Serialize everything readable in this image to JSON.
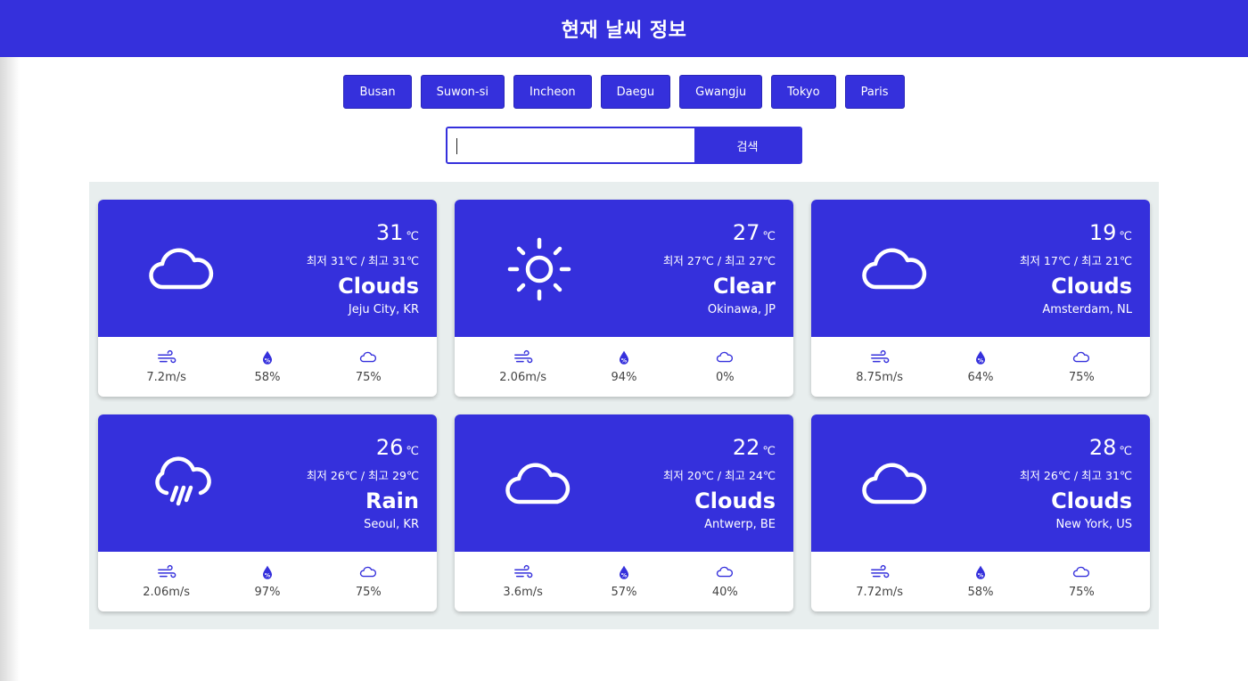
{
  "header": {
    "title": "현재 날씨 정보"
  },
  "city_buttons": [
    "Busan",
    "Suwon-si",
    "Incheon",
    "Daegu",
    "Gwangju",
    "Tokyo",
    "Paris"
  ],
  "search": {
    "value": "",
    "placeholder": "",
    "button_label": "검색"
  },
  "labels": {
    "min": "최저",
    "max": "최고",
    "unit": "℃",
    "sep": "/"
  },
  "accent_color": "#3530dc",
  "cards": [
    {
      "icon": "cloud-icon",
      "temp": "31",
      "min": "31",
      "max": "31",
      "main": "Clouds",
      "location": "Jeju City, KR",
      "wind": "7.2m/s",
      "humidity": "58%",
      "cloudiness": "75%"
    },
    {
      "icon": "sun-icon",
      "temp": "27",
      "min": "27",
      "max": "27",
      "main": "Clear",
      "location": "Okinawa, JP",
      "wind": "2.06m/s",
      "humidity": "94%",
      "cloudiness": "0%"
    },
    {
      "icon": "cloud-icon",
      "temp": "19",
      "min": "17",
      "max": "21",
      "main": "Clouds",
      "location": "Amsterdam, NL",
      "wind": "8.75m/s",
      "humidity": "64%",
      "cloudiness": "75%"
    },
    {
      "icon": "rain-cloud-icon",
      "temp": "26",
      "min": "26",
      "max": "29",
      "main": "Rain",
      "location": "Seoul, KR",
      "wind": "2.06m/s",
      "humidity": "97%",
      "cloudiness": "75%"
    },
    {
      "icon": "cloud-icon",
      "temp": "22",
      "min": "20",
      "max": "24",
      "main": "Clouds",
      "location": "Antwerp, BE",
      "wind": "3.6m/s",
      "humidity": "57%",
      "cloudiness": "40%"
    },
    {
      "icon": "cloud-icon",
      "temp": "28",
      "min": "26",
      "max": "31",
      "main": "Clouds",
      "location": "New York, US",
      "wind": "7.72m/s",
      "humidity": "58%",
      "cloudiness": "75%"
    }
  ]
}
